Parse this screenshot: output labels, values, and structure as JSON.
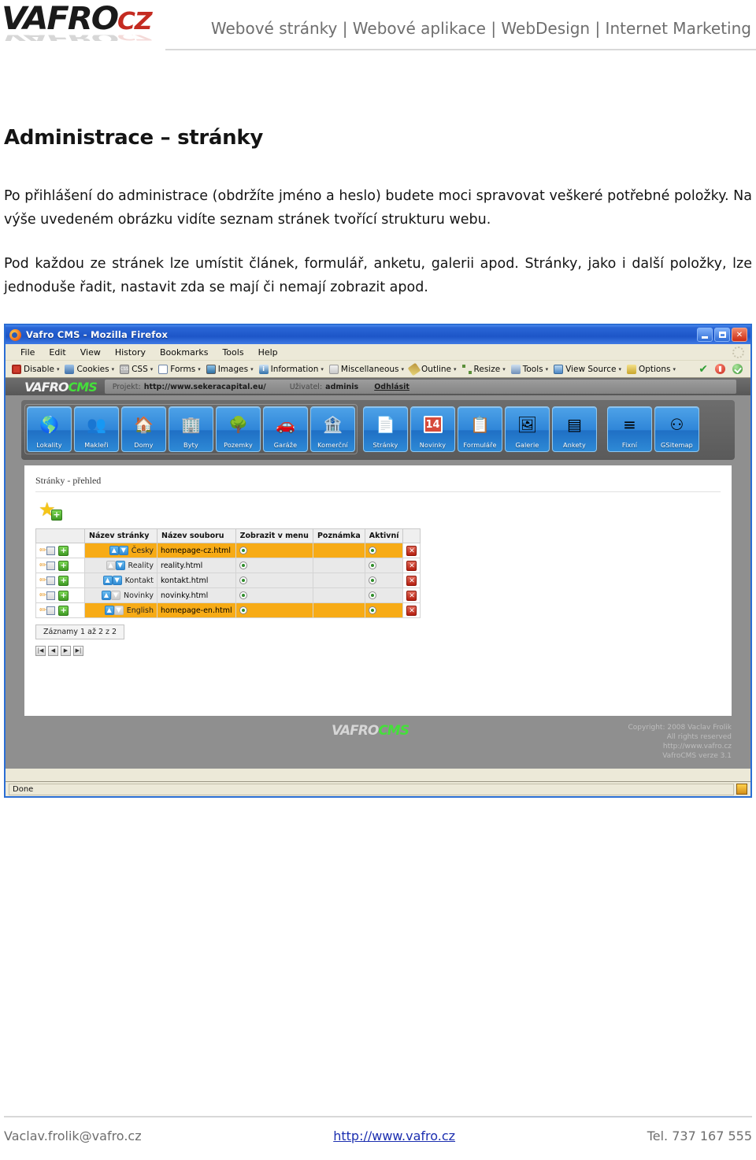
{
  "header": {
    "logo_main": "VAFRO",
    "logo_suffix": "CZ",
    "tagline": "Webové stránky | Webové aplikace | WebDesign | Internet Marketing"
  },
  "article": {
    "title": "Administrace – stránky",
    "paragraph1": "Po přihlášení do administrace (obdržíte jméno a heslo) budete moci spravovat veškeré potřebné položky. Na výše uvedeném obrázku vidíte seznam stránek tvořící strukturu webu.",
    "paragraph2": "Pod každou ze stránek lze umístit článek, formulář, anketu, galerii apod. Stránky, jako i další položky, lze jednoduše řadit, nastavit zda se mají či nemají zobrazit apod."
  },
  "screenshot": {
    "window_title": "Vafro CMS - Mozilla Firefox",
    "window_buttons": {
      "minimize": "_",
      "maximize": "□",
      "close": "✕"
    },
    "menu": [
      "File",
      "Edit",
      "View",
      "History",
      "Bookmarks",
      "Tools",
      "Help"
    ],
    "devtoolbar": [
      {
        "label": "Disable",
        "icon": "disable-icon"
      },
      {
        "label": "Cookies",
        "icon": "cookies-icon"
      },
      {
        "label": "CSS",
        "icon": "css-icon"
      },
      {
        "label": "Forms",
        "icon": "forms-icon"
      },
      {
        "label": "Images",
        "icon": "images-icon"
      },
      {
        "label": "Information",
        "icon": "information-icon"
      },
      {
        "label": "Miscellaneous",
        "icon": "miscellaneous-icon"
      },
      {
        "label": "Outline",
        "icon": "outline-icon"
      },
      {
        "label": "Resize",
        "icon": "resize-icon"
      },
      {
        "label": "Tools",
        "icon": "tools-icon"
      },
      {
        "label": "View Source",
        "icon": "view-source-icon"
      },
      {
        "label": "Options",
        "icon": "options-icon"
      }
    ],
    "cms": {
      "logo_main": "VAFRO",
      "logo_suffix": "CMS",
      "project_label": "Projekt:",
      "project_url": "http://www.sekeracapital.eu/",
      "user_label": "Uživatel:",
      "user_name": "adminis",
      "logout": "Odhlásit",
      "nav_group_1": [
        {
          "label": "Lokality",
          "icon": "globe-icon",
          "glyph": "🌎"
        },
        {
          "label": "Makleři",
          "icon": "agents-icon",
          "glyph": "👥"
        },
        {
          "label": "Domy",
          "icon": "house-icon",
          "glyph": "🏠"
        },
        {
          "label": "Byty",
          "icon": "apartment-icon",
          "glyph": "🏢"
        },
        {
          "label": "Pozemky",
          "icon": "tree-icon",
          "glyph": "🌳"
        },
        {
          "label": "Garáže",
          "icon": "car-icon",
          "glyph": "🚗"
        },
        {
          "label": "Komerční",
          "icon": "bank-icon",
          "glyph": "🏦"
        }
      ],
      "nav_group_2": [
        {
          "label": "Stránky",
          "icon": "page-icon",
          "glyph": "📄"
        },
        {
          "label": "Novinky",
          "icon": "calendar-icon",
          "glyph": "14"
        },
        {
          "label": "Formuláře",
          "icon": "form-icon",
          "glyph": "📋"
        },
        {
          "label": "Galerie",
          "icon": "gallery-icon",
          "glyph": "🖼"
        },
        {
          "label": "Ankety",
          "icon": "poll-icon",
          "glyph": "▤"
        },
        {
          "label": "Fixní",
          "icon": "fixed-icon",
          "glyph": "≡"
        },
        {
          "label": "GSitemap",
          "icon": "sitemap-icon",
          "glyph": "⚇"
        }
      ],
      "breadcrumb": "Stránky - přehled",
      "add_button_title": "+",
      "table": {
        "headers": [
          "",
          "Název stránky",
          "Název souboru",
          "Zobrazit v menu",
          "Poznámka",
          "Aktivní",
          ""
        ],
        "rows": [
          {
            "name": "Česky",
            "file": "homepage-cz.html",
            "in_menu": true,
            "note": "",
            "active": true,
            "highlight": true,
            "indent": 0,
            "up_enabled": true,
            "down_enabled": true
          },
          {
            "name": "Reality",
            "file": "reality.html",
            "in_menu": true,
            "note": "",
            "active": true,
            "highlight": false,
            "indent": 1,
            "up_enabled": false,
            "down_enabled": true
          },
          {
            "name": "Kontakt",
            "file": "kontakt.html",
            "in_menu": true,
            "note": "",
            "active": true,
            "highlight": false,
            "indent": 1,
            "up_enabled": true,
            "down_enabled": true
          },
          {
            "name": "Novinky",
            "file": "novinky.html",
            "in_menu": true,
            "note": "",
            "active": true,
            "highlight": false,
            "indent": 1,
            "up_enabled": true,
            "down_enabled": false
          },
          {
            "name": "English",
            "file": "homepage-en.html",
            "in_menu": true,
            "note": "",
            "active": true,
            "highlight": true,
            "indent": 0,
            "up_enabled": true,
            "down_enabled": false
          }
        ]
      },
      "records_text": "Záznamy 1 až 2 z 2",
      "pager": [
        "|◀",
        "◀",
        "▶",
        "▶|"
      ],
      "footer": {
        "copyright": "Copyright: 2008 Vaclav Frolik",
        "rights": "All rights reserved",
        "url": "http://www.vafro.cz",
        "version": "VafroCMS verze 3.1"
      }
    },
    "status": "Done"
  },
  "footer": {
    "email": "Vaclav.frolik@vafro.cz",
    "url": "http://www.vafro.cz",
    "phone": "Tel. 737 167 555"
  },
  "colors": {
    "brand_red": "#c42b21",
    "link_blue": "#1c2fb0",
    "highlight_orange": "#f7ab16",
    "cms_green": "#44e03a"
  }
}
